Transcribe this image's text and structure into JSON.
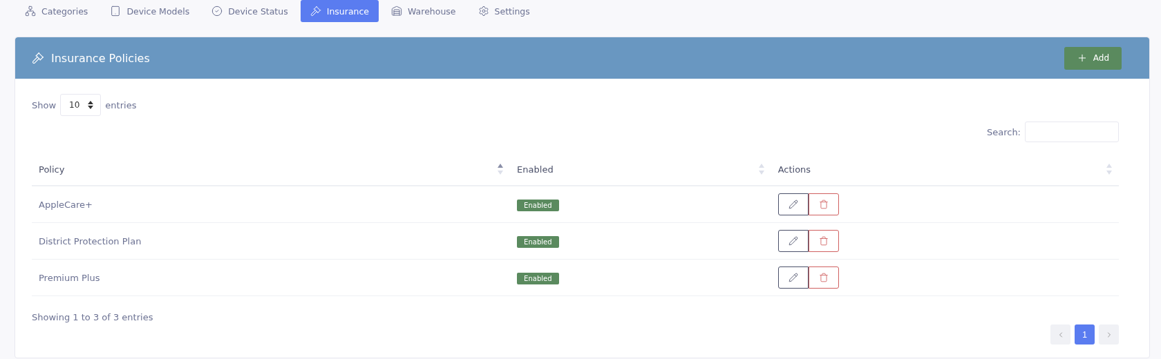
{
  "tabs": [
    {
      "label": "Categories",
      "selected": false
    },
    {
      "label": "Device Models",
      "selected": false
    },
    {
      "label": "Device Status",
      "selected": false
    },
    {
      "label": "Insurance",
      "selected": true
    },
    {
      "label": "Warehouse",
      "selected": false
    },
    {
      "label": "Settings",
      "selected": false
    }
  ],
  "panel": {
    "title": "Insurance Policies",
    "add_button": "Add"
  },
  "length_control": {
    "before": "Show",
    "value": "10",
    "after": "entries"
  },
  "search": {
    "label": "Search:"
  },
  "table": {
    "columns": [
      {
        "label": "Policy",
        "sorted": true
      },
      {
        "label": "Enabled",
        "sorted": false
      },
      {
        "label": "Actions",
        "sorted": false
      }
    ],
    "rows": [
      {
        "policy": "AppleCare+",
        "status": "Enabled"
      },
      {
        "policy": "District Protection Plan",
        "status": "Enabled"
      },
      {
        "policy": "Premium Plus",
        "status": "Enabled"
      }
    ]
  },
  "info": "Showing 1 to 3 of 3 entries",
  "pagination": {
    "pages": [
      {
        "label": "1",
        "selected": true
      }
    ]
  }
}
